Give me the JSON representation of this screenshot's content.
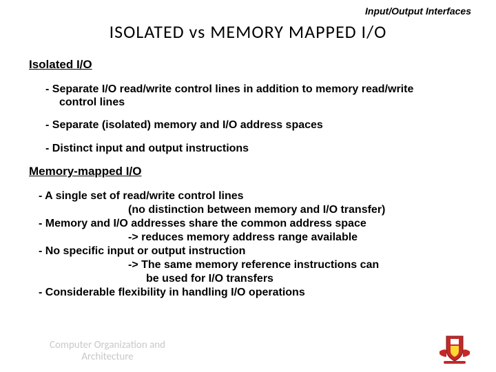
{
  "header": "Input/Output Interfaces",
  "title": "ISOLATED  vs  MEMORY  MAPPED  I/O",
  "isolated": {
    "heading": "Isolated I/O",
    "p1a": "- Separate I/O read/write control lines in addition to memory read/write",
    "p1b": "control lines",
    "p2": "- Separate (isolated) memory and I/O address spaces",
    "p3": "- Distinct input and output instructions"
  },
  "mm": {
    "heading": "Memory-mapped I/O",
    "l1": "- A single set of read/write control lines",
    "l2": "(no distinction between memory and I/O transfer)",
    "l3": "- Memory and I/O addresses share the common address space",
    "l4": "-> reduces memory address range available",
    "l5": "- No specific input or output instruction",
    "l6": "-> The same memory reference instructions can",
    "l7": "be used for I/O transfers",
    "l8": "- Considerable flexibility in handling I/O operations"
  },
  "footer": {
    "l1": "Computer Organization and",
    "l2": "Architecture"
  }
}
